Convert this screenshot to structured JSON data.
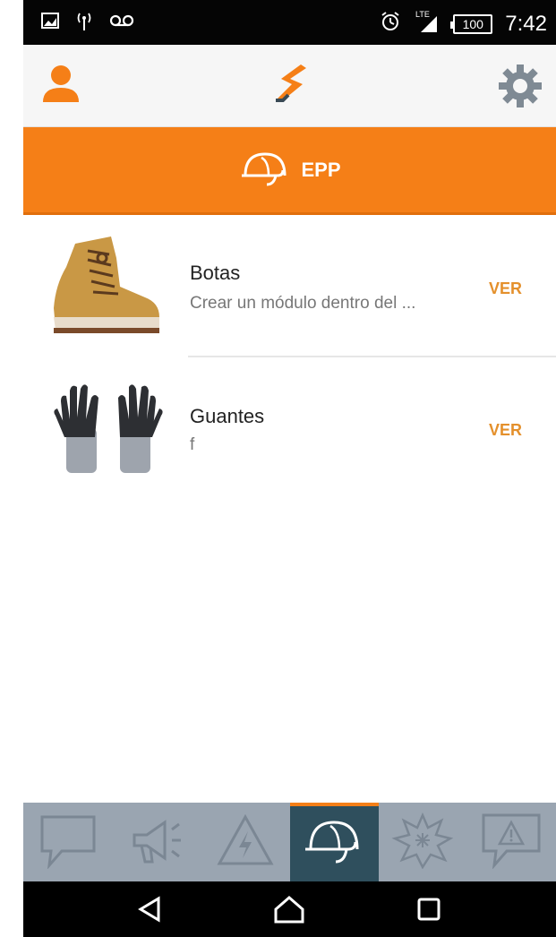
{
  "status_bar": {
    "time": "7:42",
    "battery": "100",
    "icons": [
      "image-icon",
      "signal-broadcast-icon",
      "voicemail-icon",
      "alarm-icon",
      "lte-signal-icon",
      "battery-icon"
    ]
  },
  "topbar": {
    "left_icon": "user-icon",
    "center_icon": "app-logo",
    "right_icon": "gear-icon"
  },
  "section": {
    "icon": "hard-hat-icon",
    "title": "EPP"
  },
  "items": [
    {
      "title": "Botas",
      "subtitle": "Crear un módulo dentro del ...",
      "action": "VER",
      "image": "boot-image"
    },
    {
      "title": "Guantes",
      "subtitle": "f",
      "action": "VER",
      "image": "gloves-image"
    }
  ],
  "bottom_tabs": [
    {
      "icon": "chat-icon",
      "active": false
    },
    {
      "icon": "megaphone-icon",
      "active": false
    },
    {
      "icon": "electric-hazard-icon",
      "active": false
    },
    {
      "icon": "hard-hat-icon",
      "active": true
    },
    {
      "icon": "explosion-icon",
      "active": false
    },
    {
      "icon": "warning-message-icon",
      "active": false
    }
  ],
  "colors": {
    "accent": "#f57f17",
    "action_text": "#e4902c",
    "tab_bar": "#9aa5b1",
    "tab_active": "#2f4f5d"
  }
}
